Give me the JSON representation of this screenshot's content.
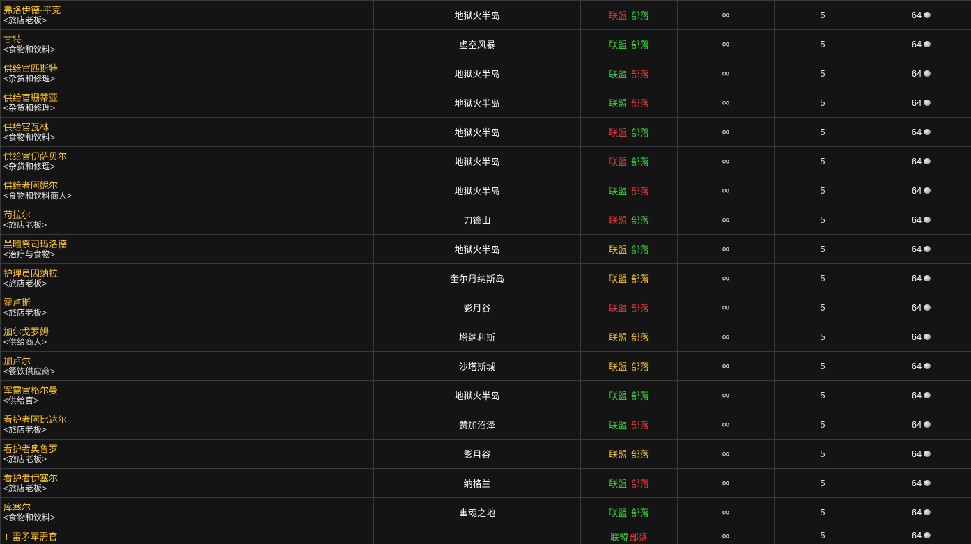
{
  "colors": {
    "npc_name": "#ffc62b",
    "friendly": "#3cd43c",
    "hostile": "#f23b3b",
    "neutral": "#ffc62b",
    "background": "#141414",
    "border": "#3a3a3a"
  },
  "rows": [
    {
      "name": "弗洛伊德·平克",
      "title": "<旅店老板>",
      "zone": "地狱火半岛",
      "alliance": "联盟",
      "horde": "部落",
      "alliance_rep": "hostile",
      "horde_rep": "friendly",
      "stock": "∞",
      "qty": "5",
      "cost": "64"
    },
    {
      "name": "甘特",
      "title": "<食物和饮料>",
      "zone": "虚空风暴",
      "alliance": "联盟",
      "horde": "部落",
      "alliance_rep": "friendly",
      "horde_rep": "friendly",
      "stock": "∞",
      "qty": "5",
      "cost": "64"
    },
    {
      "name": "供给官匹斯特",
      "title": "<杂货和修理>",
      "zone": "地狱火半岛",
      "alliance": "联盟",
      "horde": "部落",
      "alliance_rep": "friendly",
      "horde_rep": "hostile",
      "stock": "∞",
      "qty": "5",
      "cost": "64"
    },
    {
      "name": "供给官珊蒂亚",
      "title": "<杂货和修理>",
      "zone": "地狱火半岛",
      "alliance": "联盟",
      "horde": "部落",
      "alliance_rep": "friendly",
      "horde_rep": "hostile",
      "stock": "∞",
      "qty": "5",
      "cost": "64"
    },
    {
      "name": "供给官瓦林",
      "title": "<食物和饮料>",
      "zone": "地狱火半岛",
      "alliance": "联盟",
      "horde": "部落",
      "alliance_rep": "hostile",
      "horde_rep": "friendly",
      "stock": "∞",
      "qty": "5",
      "cost": "64"
    },
    {
      "name": "供给官伊萨贝尔",
      "title": "<杂货和修理>",
      "zone": "地狱火半岛",
      "alliance": "联盟",
      "horde": "部落",
      "alliance_rep": "hostile",
      "horde_rep": "friendly",
      "stock": "∞",
      "qty": "5",
      "cost": "64"
    },
    {
      "name": "供给者阿妮尔",
      "title": "<食物和饮料商人>",
      "zone": "地狱火半岛",
      "alliance": "联盟",
      "horde": "部落",
      "alliance_rep": "friendly",
      "horde_rep": "hostile",
      "stock": "∞",
      "qty": "5",
      "cost": "64"
    },
    {
      "name": "苟拉尔",
      "title": "<旅店老板>",
      "zone": "刀锋山",
      "alliance": "联盟",
      "horde": "部落",
      "alliance_rep": "hostile",
      "horde_rep": "friendly",
      "stock": "∞",
      "qty": "5",
      "cost": "64"
    },
    {
      "name": "黑暗祭司玛洛德",
      "title": "<治疗与食物>",
      "zone": "地狱火半岛",
      "alliance": "联盟",
      "horde": "部落",
      "alliance_rep": "neutral",
      "horde_rep": "friendly",
      "stock": "∞",
      "qty": "5",
      "cost": "64"
    },
    {
      "name": "护理员因纳拉",
      "title": "<旅店老板>",
      "zone": "奎尔丹纳斯岛",
      "alliance": "联盟",
      "horde": "部落",
      "alliance_rep": "neutral",
      "horde_rep": "neutral",
      "stock": "∞",
      "qty": "5",
      "cost": "64"
    },
    {
      "name": "霍卢斯",
      "title": "<旅店老板>",
      "zone": "影月谷",
      "alliance": "联盟",
      "horde": "部落",
      "alliance_rep": "hostile",
      "horde_rep": "hostile",
      "stock": "∞",
      "qty": "5",
      "cost": "64"
    },
    {
      "name": "加尔戈罗姆",
      "title": "<供给商人>",
      "zone": "塔纳利斯",
      "alliance": "联盟",
      "horde": "部落",
      "alliance_rep": "neutral",
      "horde_rep": "neutral",
      "stock": "∞",
      "qty": "5",
      "cost": "64"
    },
    {
      "name": "加卢尔",
      "title": "<餐饮供应商>",
      "zone": "沙塔斯城",
      "alliance": "联盟",
      "horde": "部落",
      "alliance_rep": "neutral",
      "horde_rep": "neutral",
      "stock": "∞",
      "qty": "5",
      "cost": "64"
    },
    {
      "name": "军需官格尔曼",
      "title": "<供给官>",
      "zone": "地狱火半岛",
      "alliance": "联盟",
      "horde": "部落",
      "alliance_rep": "friendly",
      "horde_rep": "friendly",
      "stock": "∞",
      "qty": "5",
      "cost": "64"
    },
    {
      "name": "看护者阿比达尔",
      "title": "<旅店老板>",
      "zone": "赞加沼泽",
      "alliance": "联盟",
      "horde": "部落",
      "alliance_rep": "friendly",
      "horde_rep": "hostile",
      "stock": "∞",
      "qty": "5",
      "cost": "64"
    },
    {
      "name": "看护者奥鲁罗",
      "title": "<旅店老板>",
      "zone": "影月谷",
      "alliance": "联盟",
      "horde": "部落",
      "alliance_rep": "neutral",
      "horde_rep": "neutral",
      "stock": "∞",
      "qty": "5",
      "cost": "64"
    },
    {
      "name": "看护者伊塞尔",
      "title": "<旅店老板>",
      "zone": "纳格兰",
      "alliance": "联盟",
      "horde": "部落",
      "alliance_rep": "friendly",
      "horde_rep": "hostile",
      "stock": "∞",
      "qty": "5",
      "cost": "64"
    },
    {
      "name": "库塞尔",
      "title": "<食物和饮料>",
      "zone": "幽魂之地",
      "alliance": "联盟",
      "horde": "部落",
      "alliance_rep": "friendly",
      "horde_rep": "friendly",
      "stock": "∞",
      "qty": "5",
      "cost": "64"
    }
  ],
  "last_row": {
    "icon": "quest-exclamation-icon",
    "icon_glyph": "!",
    "name": "雷矛军需官",
    "zone": "",
    "alliance": "联盟",
    "horde": "部落",
    "alliance_rep": "friendly",
    "horde_rep": "hostile",
    "stock": "∞",
    "qty": "5",
    "cost": "64"
  }
}
